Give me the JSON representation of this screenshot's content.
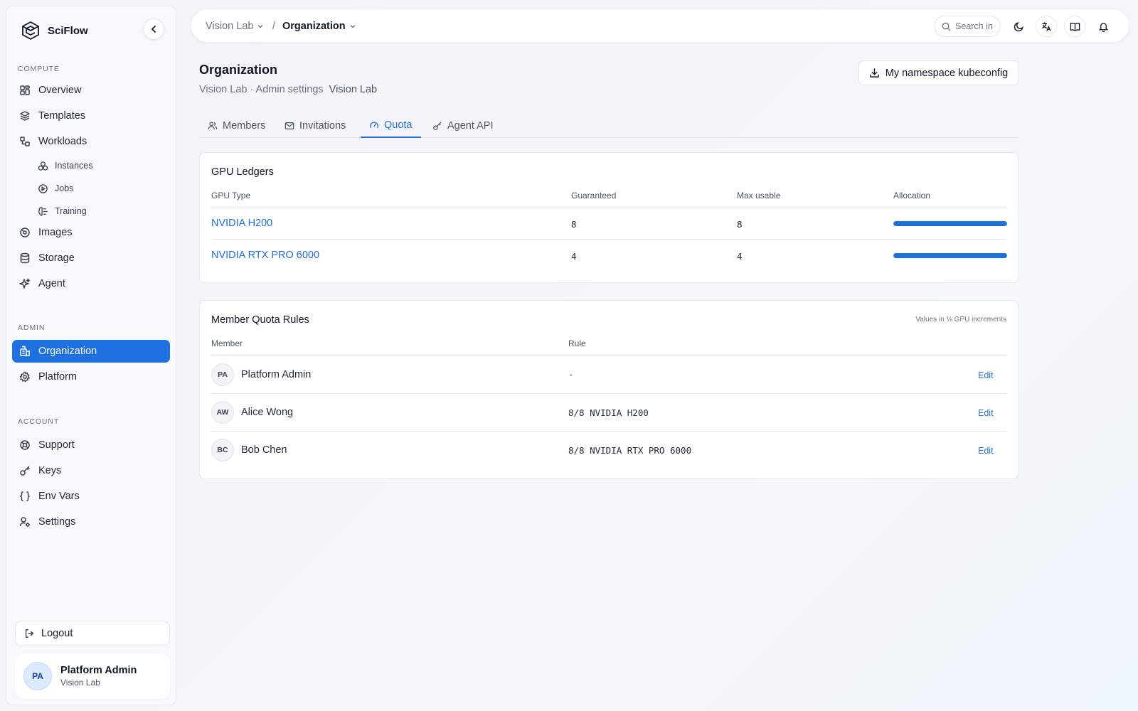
{
  "app": {
    "name": "SciFlow"
  },
  "sidebar": {
    "sections": {
      "compute": "COMPUTE",
      "admin": "ADMIN",
      "account": "ACCOUNT"
    },
    "compute_items": [
      {
        "label": "Overview",
        "icon": "grid-icon"
      },
      {
        "label": "Templates",
        "icon": "layers-icon"
      },
      {
        "label": "Workloads",
        "icon": "workflow-icon"
      }
    ],
    "workload_subitems": [
      {
        "label": "Instances",
        "icon": "cubes-icon"
      },
      {
        "label": "Jobs",
        "icon": "play-circle-icon"
      },
      {
        "label": "Training",
        "icon": "brain-icon"
      }
    ],
    "compute_items_2": [
      {
        "label": "Images",
        "icon": "disc-icon"
      },
      {
        "label": "Storage",
        "icon": "database-icon"
      },
      {
        "label": "Agent",
        "icon": "sparkles-icon"
      }
    ],
    "admin_items": [
      {
        "label": "Organization",
        "icon": "building-icon",
        "active": true
      },
      {
        "label": "Platform",
        "icon": "gear-icon"
      }
    ],
    "account_items": [
      {
        "label": "Support",
        "icon": "lifebuoy-icon"
      },
      {
        "label": "Keys",
        "icon": "key-icon"
      },
      {
        "label": "Env Vars",
        "icon": "braces-icon"
      },
      {
        "label": "Settings",
        "icon": "user-cog-icon"
      }
    ],
    "logout_label": "Logout",
    "user": {
      "initials": "PA",
      "name": "Platform Admin",
      "org": "Vision Lab"
    }
  },
  "topbar": {
    "breadcrumb": {
      "org": "Vision Lab",
      "separator": "/",
      "page": "Organization"
    },
    "search_placeholder": "Search in"
  },
  "header": {
    "title": "Organization",
    "subtitle": "Vision Lab · Admin settings",
    "org_badge": "Vision Lab",
    "kubeconfig_label": "My namespace kubeconfig"
  },
  "tabs": [
    {
      "label": "Members",
      "icon": "users-icon"
    },
    {
      "label": "Invitations",
      "icon": "mail-icon"
    },
    {
      "label": "Quota",
      "icon": "gauge-icon",
      "active": true
    },
    {
      "label": "Agent API",
      "icon": "key-icon"
    }
  ],
  "gpu_ledgers": {
    "title": "GPU Ledgers",
    "columns": [
      "GPU Type",
      "Guaranteed",
      "Max usable",
      "Allocation"
    ],
    "rows": [
      {
        "gpu": "NVIDIA H200",
        "guaranteed": "8",
        "max": "8",
        "allocation": 1.0
      },
      {
        "gpu": "NVIDIA RTX PRO 6000",
        "guaranteed": "4",
        "max": "4",
        "allocation": 1.0
      }
    ]
  },
  "quota_rules": {
    "title": "Member Quota Rules",
    "note": "Values in ⅛ GPU increments",
    "columns": [
      "Member",
      "Rule"
    ],
    "edit_label": "Edit",
    "rows": [
      {
        "initials": "PA",
        "name": "Platform Admin",
        "rule": "-"
      },
      {
        "initials": "AW",
        "name": "Alice Wong",
        "rule": "8/8 NVIDIA H200"
      },
      {
        "initials": "BC",
        "name": "Bob Chen",
        "rule": "8/8 NVIDIA RTX PRO 6000"
      }
    ]
  },
  "colors": {
    "accent": "#1e6fe0"
  }
}
